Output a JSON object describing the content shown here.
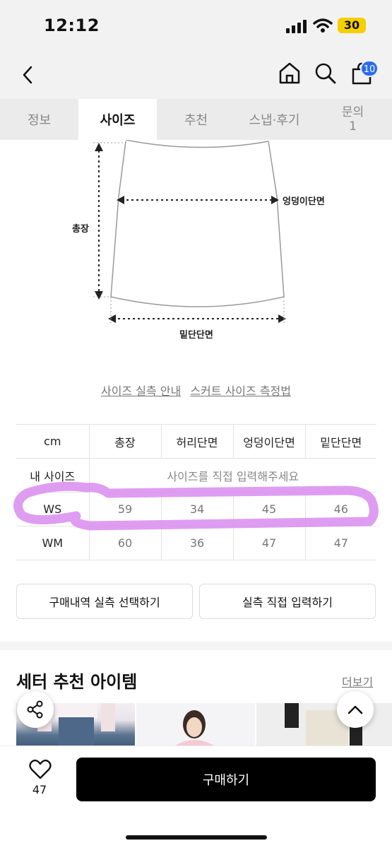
{
  "status": {
    "time": "12:12",
    "battery": "30"
  },
  "nav": {
    "cart_count": "10"
  },
  "tabs": [
    {
      "label": "정보"
    },
    {
      "label": "사이즈"
    },
    {
      "label": "추천"
    },
    {
      "label": "스냅·후기"
    },
    {
      "label": "문의",
      "count": "1"
    }
  ],
  "diagram": {
    "hip_label": "엉덩이단면",
    "length_label": "총장",
    "hem_label": "밑단단면"
  },
  "links": {
    "guide": "사이즈 실측 안내",
    "skirt_measure": "스커트 사이즈 측정법"
  },
  "size_table": {
    "headers": [
      "cm",
      "총장",
      "허리단면",
      "엉덩이단면",
      "밑단단면"
    ],
    "my_size_label": "내 사이즈",
    "my_size_placeholder": "사이즈를 직접 입력해주세요",
    "rows": [
      {
        "size": "WS",
        "values": [
          "59",
          "34",
          "45",
          "46"
        ]
      },
      {
        "size": "WM",
        "values": [
          "60",
          "36",
          "47",
          "47"
        ]
      }
    ]
  },
  "actions": {
    "purchase_history": "구매내역 실측 선택하기",
    "direct_input": "실측 직접 입력하기"
  },
  "recommend": {
    "title": "세터 추천 아이템",
    "more": "더보기"
  },
  "bottom": {
    "like_count": "47",
    "buy_label": "구매하기"
  },
  "colors": {
    "highlight": "#d98cf0",
    "badge": "#2b6cf0",
    "battery": "#f5d000"
  }
}
